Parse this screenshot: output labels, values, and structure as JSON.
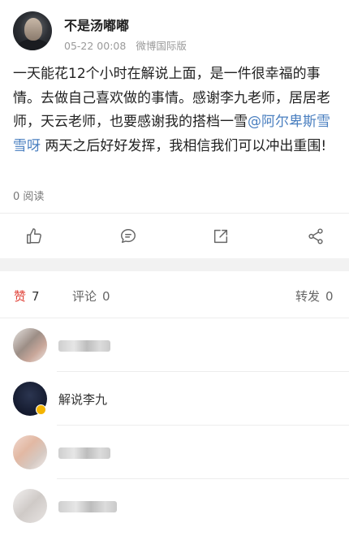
{
  "post": {
    "author": "不是汤嘟嘟",
    "timestamp": "05-22 00:08",
    "source": "微博国际版",
    "text_before_mention": "一天能花12个小时在解说上面，是一件很幸福的事情。去做自己喜欢做的事情。感谢李九老师，居居老师，天云老师，也要感谢我的搭档一雪",
    "mention": "@阿尔卑斯雪雪呀",
    "text_after_mention": " 两天之后好好发挥，我相信我们可以冲出重围!",
    "read_count": "0 阅读"
  },
  "actions": [
    {
      "name": "like",
      "icon": "thumbs-up-icon"
    },
    {
      "name": "comment",
      "icon": "comment-bubble-icon"
    },
    {
      "name": "repost",
      "icon": "share-arrow-icon"
    },
    {
      "name": "share",
      "icon": "share-nodes-icon"
    }
  ],
  "tabs": {
    "likes": {
      "label": "赞",
      "count": "7"
    },
    "comments": {
      "label": "评论",
      "count": "0"
    },
    "reposts": {
      "label": "转发",
      "count": "0"
    }
  },
  "likers": [
    {
      "name": "",
      "blurred": true
    },
    {
      "name": "解说李九",
      "blurred": false,
      "verified": true
    },
    {
      "name": "",
      "blurred": true
    },
    {
      "name": "",
      "blurred": true
    }
  ],
  "colors": {
    "accent": "#e0443a",
    "mention": "#4a7fc0",
    "separator": "#ededed"
  }
}
